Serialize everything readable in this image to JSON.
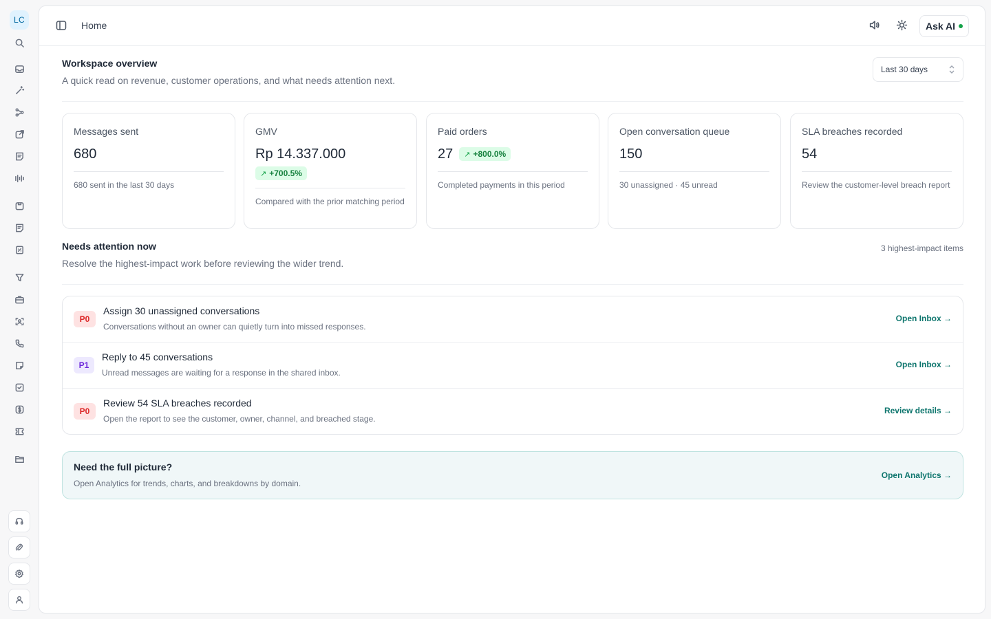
{
  "sidebar": {
    "avatar_initials": "LC",
    "icons": [
      "search-icon",
      "inbox-icon",
      "magic-wand-icon",
      "workflow-icon",
      "external-link-icon",
      "notes-icon",
      "broadcast-icon",
      "package-icon",
      "document-icon",
      "invoice-icon",
      "filter-icon",
      "briefcase-icon",
      "scan-face-icon",
      "phone-icon",
      "sticky-note-icon",
      "checklist-icon",
      "dollar-icon",
      "ticket-icon",
      "folder-icon"
    ],
    "bottom_icons": [
      "headset-icon",
      "attachment-icon",
      "settings-icon",
      "user-icon"
    ]
  },
  "topbar": {
    "breadcrumb": "Home",
    "ask_ai_label": "Ask AI"
  },
  "overview": {
    "title": "Workspace overview",
    "subtitle": "A quick read on revenue, customer operations, and what needs attention next.",
    "range_value": "Last 30 days"
  },
  "metrics": [
    {
      "label": "Messages sent",
      "value": "680",
      "badge": "",
      "note": "680 sent in the last 30 days"
    },
    {
      "label": "GMV",
      "value": "Rp 14.337.000",
      "badge": "+700.5%",
      "note": "Compared with the prior matching period"
    },
    {
      "label": "Paid orders",
      "value": "27",
      "badge": "+800.0%",
      "note": "Completed payments in this period"
    },
    {
      "label": "Open conversation queue",
      "value": "150",
      "badge": "",
      "note": "30 unassigned · 45 unread"
    },
    {
      "label": "SLA breaches recorded",
      "value": "54",
      "badge": "",
      "note": "Review the customer-level breach report"
    }
  ],
  "attention": {
    "title": "Needs attention now",
    "subtitle": "Resolve the highest-impact work before reviewing the wider trend.",
    "count_label": "3 highest-impact items",
    "items": [
      {
        "priority": "P0",
        "title": "Assign 30 unassigned conversations",
        "desc": "Conversations without an owner can quietly turn into missed responses.",
        "link": "Open Inbox →"
      },
      {
        "priority": "P1",
        "title": "Reply to 45 conversations",
        "desc": "Unread messages are waiting for a response in the shared inbox.",
        "link": "Open Inbox →"
      },
      {
        "priority": "P0",
        "title": "Review 54 SLA breaches recorded",
        "desc": "Open the report to see the customer, owner, channel, and breached stage.",
        "link": "Review details →"
      }
    ]
  },
  "promo": {
    "title": "Need the full picture?",
    "subtitle": "Open Analytics for trends, charts, and breakdowns by domain.",
    "link": "Open Analytics →"
  },
  "colors": {
    "accent": "#0f766e",
    "positive_badge_bg": "#dcfce7",
    "positive_badge_text": "#15803d",
    "p0_bg": "#fee2e2",
    "p0_text": "#dc2626",
    "p1_bg": "#ede9fe",
    "p1_text": "#6d28d9",
    "status_online": "#16a34a"
  }
}
